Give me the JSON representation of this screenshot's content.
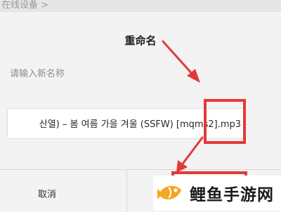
{
  "background": {
    "partial_text": "在线设备 >"
  },
  "dialog": {
    "title": "重命名",
    "prompt": "请输入新名称",
    "input_value": "산열) – 봄 여름 가을 겨울 (SSFW) [mqms2].mp3",
    "cancel_label": "取消",
    "confirm_label": ""
  },
  "watermark": {
    "text": "鲤鱼手游网"
  },
  "colors": {
    "annotation": "#e53935",
    "dialog_bg": "#f3f3f3",
    "input_bg": "#ffffff",
    "logo": "#f5a623"
  },
  "icons": {
    "annotation_arrow_top": "arrow-down-right-icon",
    "annotation_arrow_bottom": "arrow-down-left-icon",
    "watermark_logo": "fish-logo-icon"
  }
}
